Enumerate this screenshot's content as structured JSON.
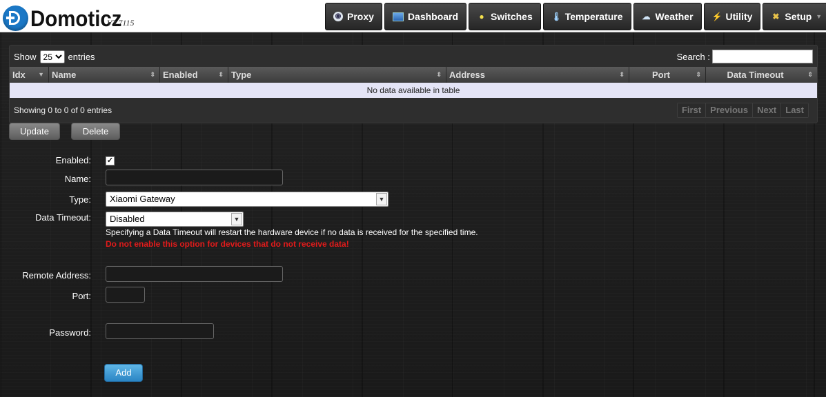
{
  "app": {
    "name": "Domoticz",
    "version": "V3.7115"
  },
  "nav": [
    {
      "label": "Proxy",
      "icon": "proxy-icon"
    },
    {
      "label": "Dashboard",
      "icon": "dashboard-icon"
    },
    {
      "label": "Switches",
      "icon": "lightbulb-icon"
    },
    {
      "label": "Temperature",
      "icon": "thermometer-icon"
    },
    {
      "label": "Weather",
      "icon": "cloud-rain-icon"
    },
    {
      "label": "Utility",
      "icon": "utility-icon"
    },
    {
      "label": "Setup",
      "icon": "tools-icon"
    }
  ],
  "table": {
    "show_label": "Show",
    "entries_value": "25",
    "entries_label": "entries",
    "search_label": "Search :",
    "search_value": "",
    "columns": [
      "Idx",
      "Name",
      "Enabled",
      "Type",
      "Address",
      "Port",
      "Data Timeout"
    ],
    "empty_text": "No data available in table",
    "info": "Showing 0 to 0 of 0 entries",
    "pager": [
      "First",
      "Previous",
      "Next",
      "Last"
    ]
  },
  "actions": {
    "update": "Update",
    "delete": "Delete"
  },
  "form": {
    "enabled_label": "Enabled:",
    "enabled_checked": true,
    "name_label": "Name:",
    "name_value": "",
    "type_label": "Type:",
    "type_value": "Xiaomi Gateway",
    "timeout_label": "Data Timeout:",
    "timeout_value": "Disabled",
    "timeout_help": "Specifying a Data Timeout will restart the hardware device if no data is received for the specified time.",
    "timeout_warning": "Do not enable this option for devices that do not receive data!",
    "remote_address_label": "Remote Address:",
    "remote_address_value": "",
    "port_label": "Port:",
    "port_value": "",
    "password_label": "Password:",
    "password_value": "",
    "add_label": "Add"
  }
}
